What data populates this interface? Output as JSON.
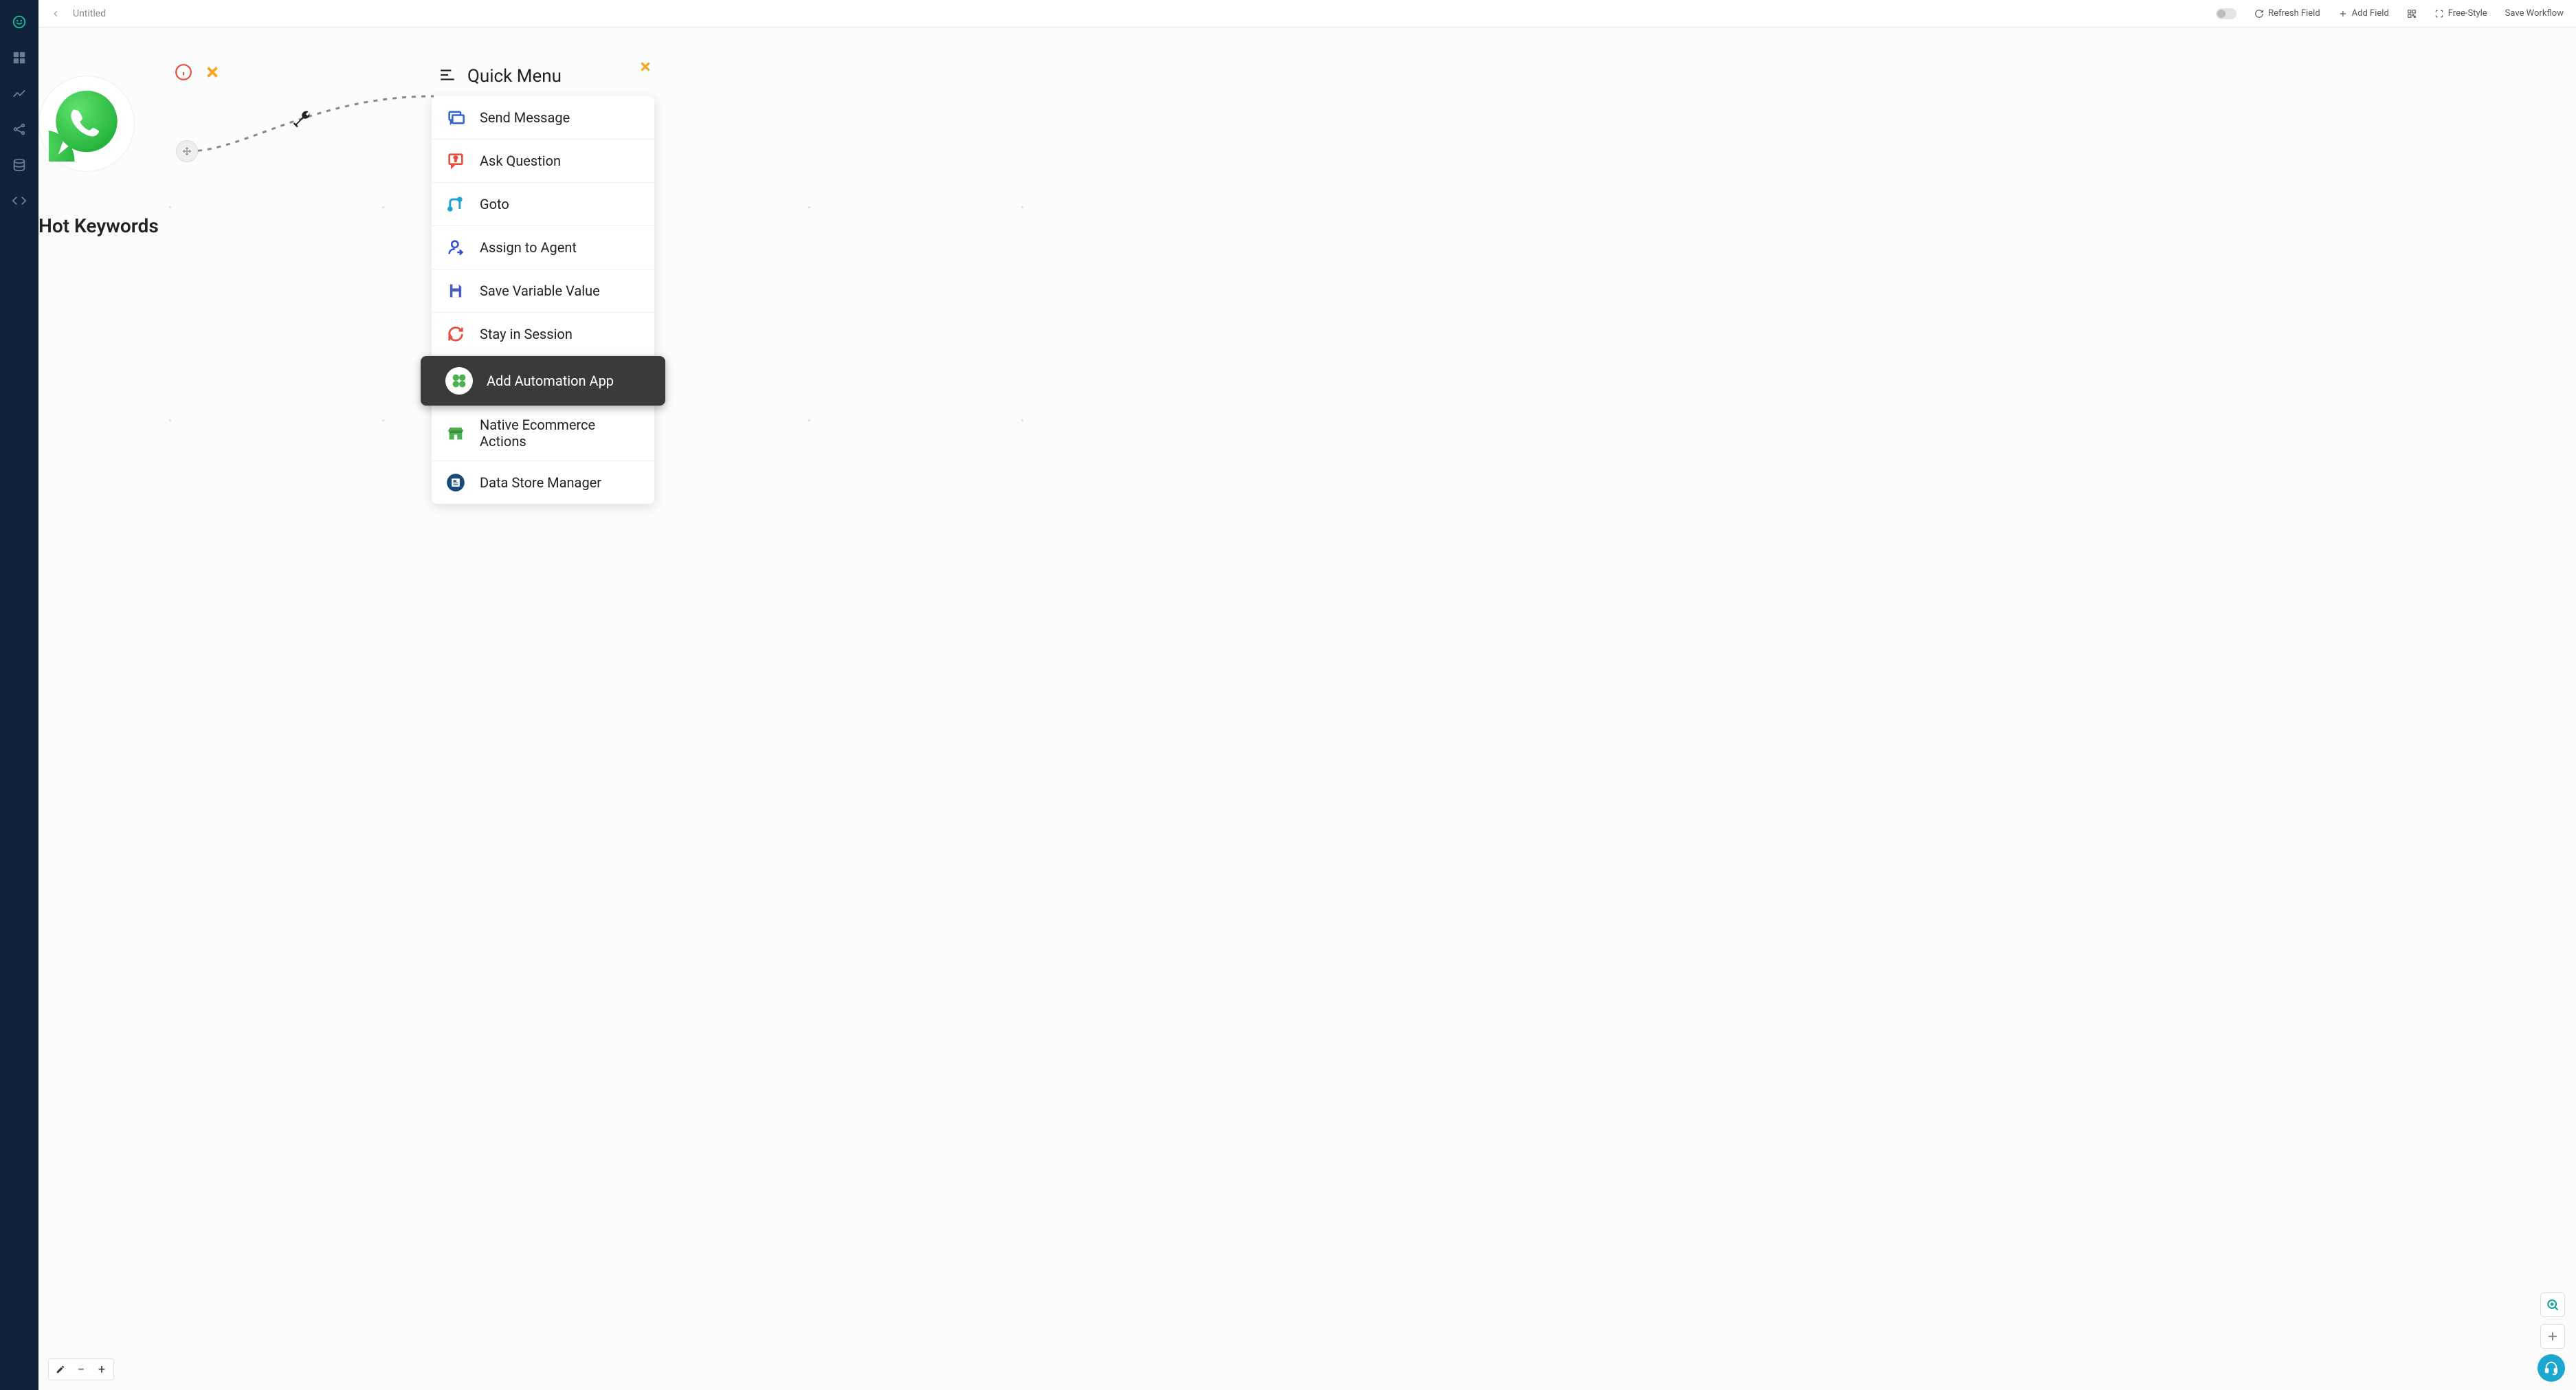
{
  "topbar": {
    "title": "Untitled",
    "refresh_label": "Refresh Field",
    "add_field_label": "Add Field",
    "free_style_label": "Free-Style",
    "save_label": "Save Workflow"
  },
  "canvas": {
    "hot_keywords_label": "Hot Keywords"
  },
  "quick_menu": {
    "title": "Quick Menu",
    "items": [
      {
        "label": "Send Message"
      },
      {
        "label": "Ask Question"
      },
      {
        "label": "Goto"
      },
      {
        "label": "Assign to Agent"
      },
      {
        "label": "Save Variable Value"
      },
      {
        "label": "Stay in Session"
      },
      {
        "label": "Add Automation App"
      },
      {
        "label": "Native Ecommerce Actions"
      },
      {
        "label": "Data Store Manager"
      }
    ],
    "highlighted_index": 6
  }
}
